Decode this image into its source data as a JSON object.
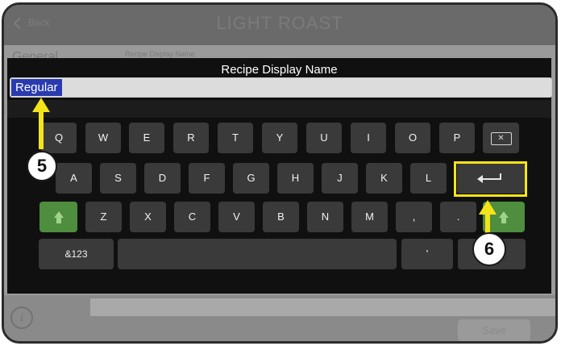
{
  "header": {
    "back_label": "Back",
    "title": "LIGHT ROAST"
  },
  "background": {
    "general_label": "General",
    "recipe_display_name_label": "Recipe Display Name"
  },
  "footer": {
    "info_label": "i",
    "save_label": "Save"
  },
  "keyboard": {
    "title": "Recipe Display Name",
    "input_value": "Regular",
    "row1": [
      "Q",
      "W",
      "E",
      "R",
      "T",
      "Y",
      "U",
      "I",
      "O",
      "P"
    ],
    "row2": [
      "A",
      "S",
      "D",
      "F",
      "G",
      "H",
      "J",
      "K",
      "L"
    ],
    "row3": [
      "Z",
      "X",
      "C",
      "V",
      "B",
      "N",
      "M",
      ",",
      "."
    ],
    "symbols_label": "&123",
    "apostrophe": "'"
  },
  "annotations": {
    "callout_5": "5",
    "callout_6": "6",
    "highlight_color": "#f5e31a",
    "selection_color": "#2a3bb0",
    "shift_color": "#4f8d3f"
  }
}
